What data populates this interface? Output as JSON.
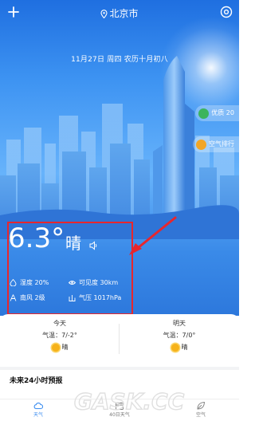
{
  "header": {
    "city": "北京市",
    "date_line": "11月27日 周四 农历十月初八"
  },
  "side_badges": {
    "air_quality": "优质 20",
    "air_ranking": "空气排行"
  },
  "current": {
    "temperature": "6.3°",
    "condition": "晴",
    "humidity": "湿度 20%",
    "visibility": "可见度 30km",
    "wind": "南风 2级",
    "pressure": "气压 1017hPa"
  },
  "forecast": {
    "today": {
      "label": "今天",
      "temp": "气温：7/-2°",
      "condition": "晴"
    },
    "tomorrow": {
      "label": "明天",
      "temp": "气温：7/0°",
      "condition": "晴"
    }
  },
  "hourly": {
    "title": "未来24小时预报"
  },
  "nav": {
    "weather": "天气",
    "forty_day": "40日天气",
    "air": "空气"
  },
  "watermark": {
    "text": "GASK.CC"
  },
  "colors": {
    "sky_top": "#1f6fe0",
    "sky_mid": "#67b3fb",
    "highlight_box": "#e8262d",
    "sun": "#f6b21a",
    "nav_active": "#3d8ef0"
  }
}
